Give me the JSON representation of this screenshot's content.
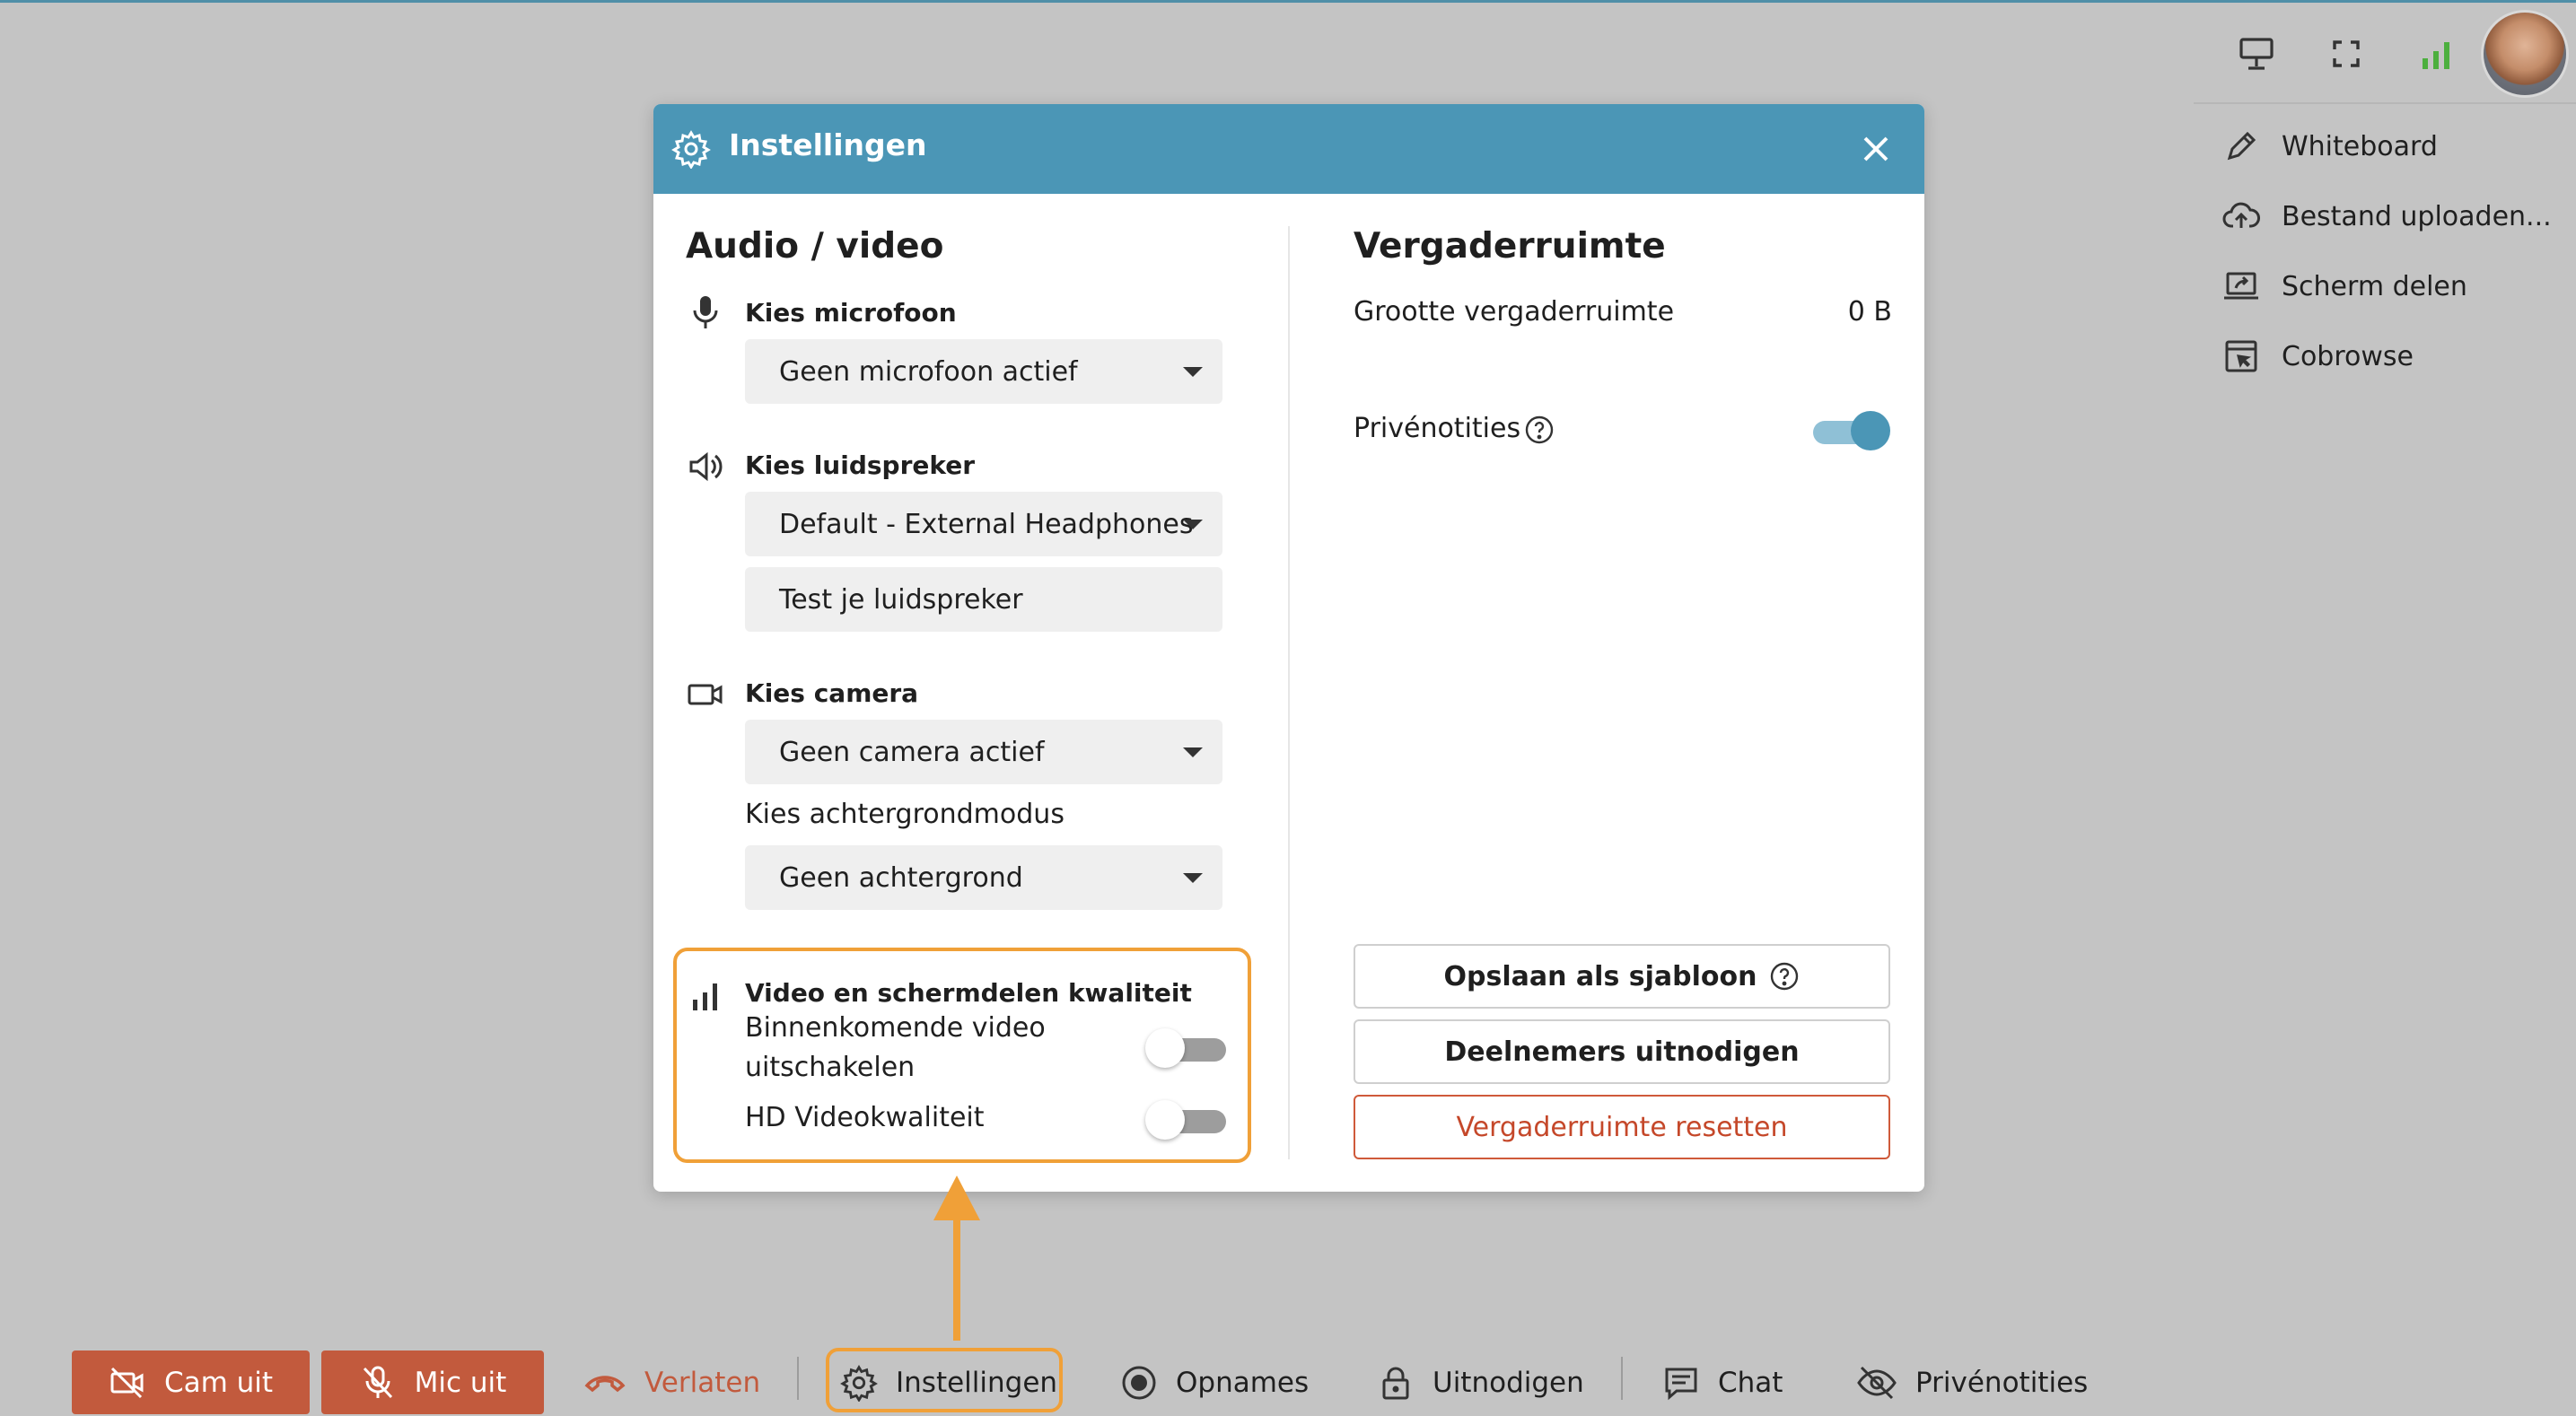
{
  "window": {
    "accent": "#4b96b6",
    "highlight": "#f0a038",
    "danger": "#c25a3d"
  },
  "topbar": {
    "icons": [
      "presentation-icon",
      "fullscreen-icon",
      "signal-strength-icon",
      "avatar"
    ]
  },
  "sidebar": {
    "items": [
      {
        "label": "Whiteboard",
        "icon": "pencil-icon"
      },
      {
        "label": "Bestand uploaden...",
        "icon": "cloud-upload-icon"
      },
      {
        "label": "Scherm delen",
        "icon": "screen-share-icon"
      },
      {
        "label": "Cobrowse",
        "icon": "cobrowse-icon"
      }
    ]
  },
  "modal": {
    "title": "Instellingen",
    "left": {
      "heading": "Audio / video",
      "microphone": {
        "label": "Kies microfoon",
        "value": "Geen microfoon actief"
      },
      "speaker": {
        "label": "Kies luidspreker",
        "value": "Default - External Headphones",
        "test_button": "Test je luidspreker"
      },
      "camera": {
        "label": "Kies camera",
        "value": "Geen camera actief"
      },
      "background": {
        "label": "Kies achtergrondmodus",
        "value": "Geen achtergrond"
      },
      "quality": {
        "label": "Video en schermdelen kwaliteit",
        "incoming_video_line1": "Binnenkomende video",
        "incoming_video_line2": "uitschakelen",
        "incoming_video_on": false,
        "hd_label": "HD Videokwaliteit",
        "hd_on": false
      }
    },
    "right": {
      "heading": "Vergaderruimte",
      "size_label": "Grootte vergaderruimte",
      "size_value": "0 B",
      "private_notes_label": "Privénotities",
      "private_notes_on": true,
      "save_template_button": "Opslaan als sjabloon",
      "invite_button": "Deelnemers uitnodigen",
      "reset_button": "Vergaderruimte resetten"
    }
  },
  "bottombar": {
    "cam": "Cam uit",
    "mic": "Mic uit",
    "leave": "Verlaten",
    "settings": "Instellingen",
    "recordings": "Opnames",
    "invite": "Uitnodigen",
    "chat": "Chat",
    "private_notes": "Privénotities"
  }
}
